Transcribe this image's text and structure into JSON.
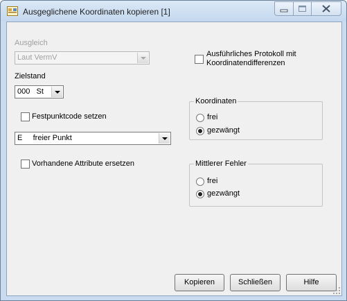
{
  "window": {
    "title": "Ausgeglichene Koordinaten kopieren [1]",
    "icons": {
      "app": "app-icon",
      "minimize": "minimize-icon",
      "maximize": "maximize-icon",
      "close": "close-icon"
    }
  },
  "ausgleich": {
    "label": "Ausgleich",
    "value": "Laut VermV"
  },
  "zielstand": {
    "label": "Zielstand",
    "value": "000   St"
  },
  "festpunkt": {
    "label": "Festpunktcode setzen",
    "checked": false,
    "value": "E     freier Punkt"
  },
  "attribute": {
    "label": "Vorhandene Attribute ersetzen",
    "checked": false
  },
  "protokoll": {
    "label_line1": "Ausführliches Protokoll mit",
    "label_line2": "Koordinatendifferenzen",
    "checked": false
  },
  "koordinaten": {
    "title": "Koordinaten",
    "options": [
      "frei",
      "gezwängt"
    ],
    "selected": "gezwängt"
  },
  "fehler": {
    "title": "Mittlerer Fehler",
    "options": [
      "frei",
      "gezwängt"
    ],
    "selected": "gezwängt"
  },
  "buttons": {
    "copy": "Kopieren",
    "close": "Schließen",
    "help": "Hilfe"
  },
  "colors": {
    "title_bar": "#c9dbef",
    "dialog_bg": "#f0f0f0",
    "close_button": "#c45252"
  }
}
